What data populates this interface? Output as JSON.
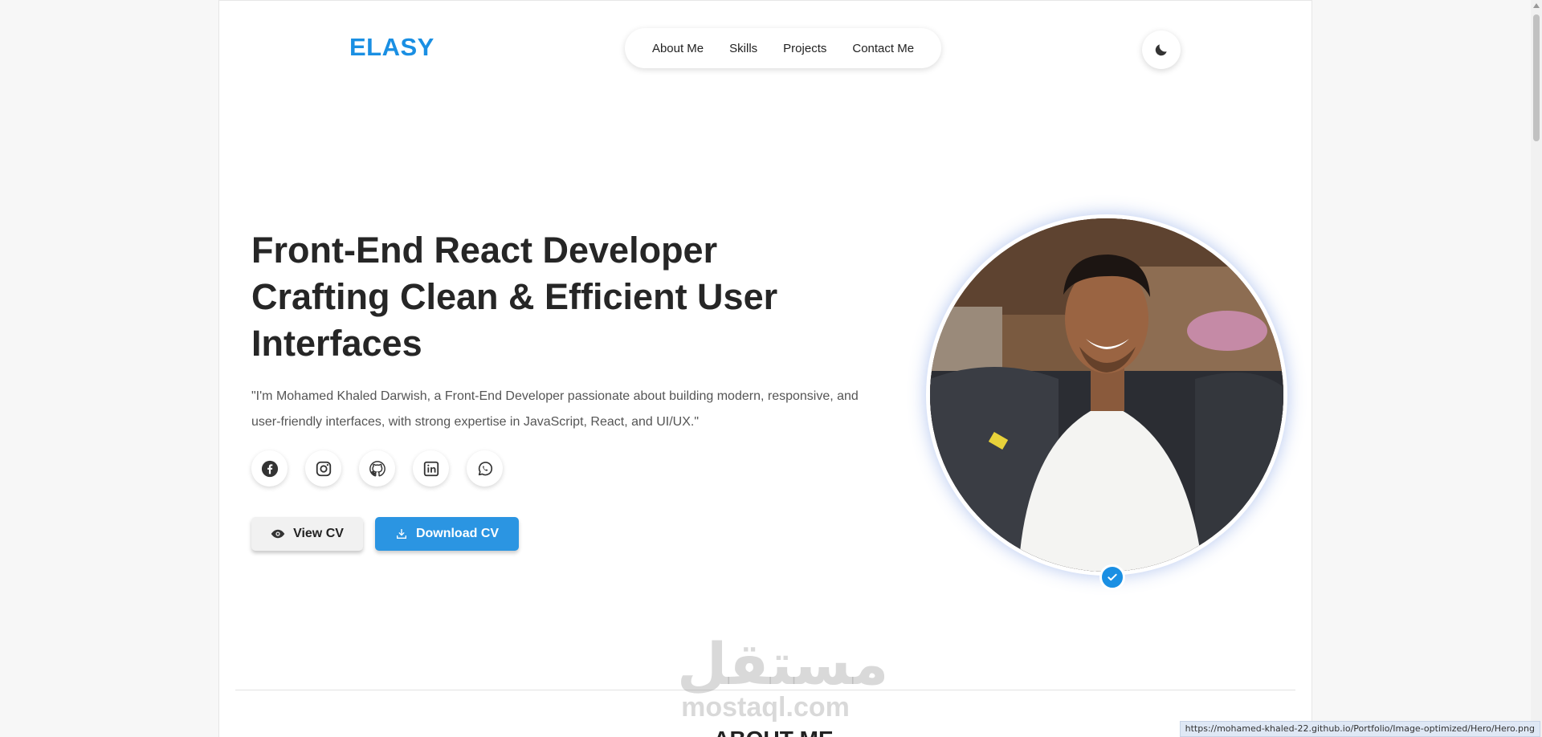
{
  "header": {
    "logo": "ELASY",
    "nav": [
      "About Me",
      "Skills",
      "Projects",
      "Contact Me"
    ],
    "theme_toggle_icon": "moon-icon"
  },
  "hero": {
    "title_lines": [
      "Front-End React Developer",
      "Crafting Clean & Efficient User",
      "Interfaces"
    ],
    "description": "\"I'm Mohamed Khaled Darwish, a Front-End Developer passionate about building modern, responsive, and user-friendly interfaces, with strong expertise in JavaScript, React, and UI/UX.\"",
    "socials": [
      "facebook-icon",
      "instagram-icon",
      "github-icon",
      "linkedin-icon",
      "whatsapp-icon"
    ],
    "view_cv_label": "View CV",
    "download_cv_label": "Download CV",
    "photo_alt": "Hero"
  },
  "next_section": {
    "title_peek": "ABOUT ME"
  },
  "watermark": {
    "arabic": "مستقل",
    "latin": "mostaql.com"
  },
  "status_bar": {
    "url": "https://mohamed-khaled-22.github.io/Portfolio/Image-optimized/Hero/Hero.png"
  },
  "colors": {
    "accent": "#1a8fe3",
    "button_blue": "#2b95e2"
  }
}
